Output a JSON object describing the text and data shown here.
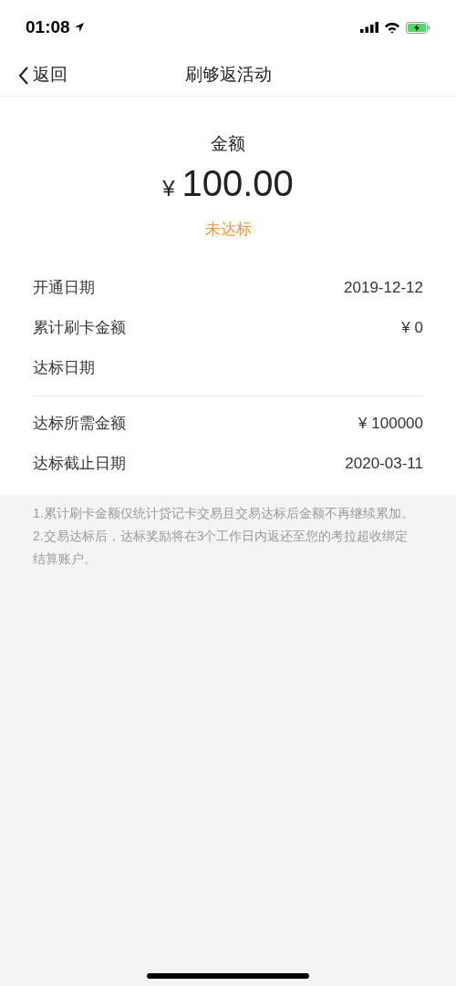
{
  "status_bar": {
    "time": "01:08"
  },
  "nav": {
    "back": "返回",
    "title": "刷够返活动"
  },
  "summary": {
    "label": "金额",
    "currency": "¥",
    "amount": "100.00",
    "status": "未达标"
  },
  "detail_groups": [
    [
      {
        "label": "开通日期",
        "value": "2019-12-12"
      },
      {
        "label": "累计刷卡金额",
        "value": "¥ 0"
      },
      {
        "label": "达标日期"
      }
    ],
    [
      {
        "label": "达标所需金额",
        "value": "¥ 100000"
      },
      {
        "label": "达标截止日期",
        "value": "2020-03-11"
      }
    ]
  ],
  "notes": [
    "1.累计刷卡金额仅统计贷记卡交易且交易达标后金额不再继续累加。",
    "2.交易达标后，达标奖励将在3个工作日内返还至您的考拉超收绑定结算账户。"
  ]
}
